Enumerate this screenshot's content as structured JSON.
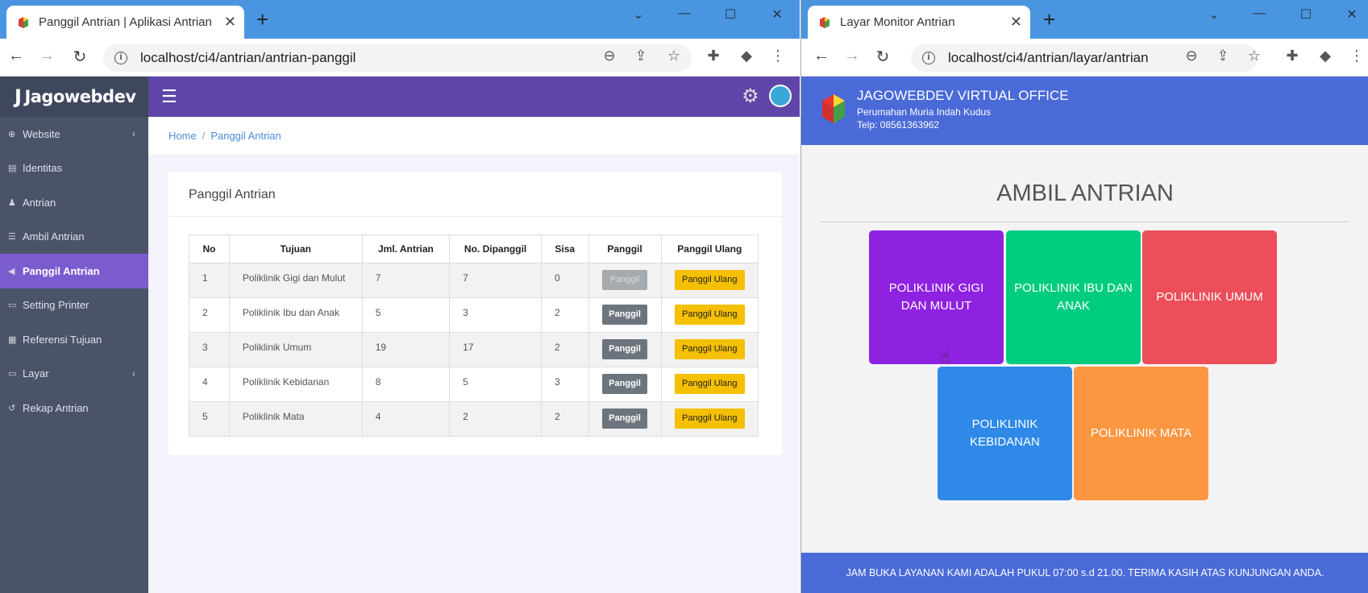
{
  "left_window": {
    "tab_title": "Panggil Antrian | Aplikasi Antrian",
    "url": "localhost/ci4/antrian/antrian-panggil",
    "brand": "Jagowebdev",
    "sidebar": [
      {
        "label": "Website",
        "icon": "globe-icon",
        "has_children": true
      },
      {
        "label": "Identitas",
        "icon": "clipboard-icon",
        "has_children": false
      },
      {
        "label": "Antrian",
        "icon": "users-icon",
        "has_children": false
      },
      {
        "label": "Ambil Antrian",
        "icon": "list-icon",
        "has_children": false
      },
      {
        "label": "Panggil Antrian",
        "icon": "speaker-icon",
        "has_children": false,
        "active": true
      },
      {
        "label": "Setting Printer",
        "icon": "printer-icon",
        "has_children": false
      },
      {
        "label": "Referensi Tujuan",
        "icon": "building-icon",
        "has_children": false
      },
      {
        "label": "Layar",
        "icon": "monitor-icon",
        "has_children": true
      },
      {
        "label": "Rekap Antrian",
        "icon": "history-icon",
        "has_children": false
      }
    ],
    "breadcrumb": {
      "home": "Home",
      "current": "Panggil Antrian"
    },
    "card_title": "Panggil Antrian",
    "table": {
      "headers": [
        "No",
        "Tujuan",
        "Jml. Antrian",
        "No. Dipanggil",
        "Sisa",
        "Panggil",
        "Panggil Ulang"
      ],
      "rows": [
        {
          "no": "1",
          "tujuan": "Poliklinik Gigi dan Mulut",
          "jml": "7",
          "dipanggil": "7",
          "sisa": "0",
          "disabled": true
        },
        {
          "no": "2",
          "tujuan": "Poliklinik Ibu dan Anak",
          "jml": "5",
          "dipanggil": "3",
          "sisa": "2",
          "disabled": false
        },
        {
          "no": "3",
          "tujuan": "Poliklinik Umum",
          "jml": "19",
          "dipanggil": "17",
          "sisa": "2",
          "disabled": false
        },
        {
          "no": "4",
          "tujuan": "Poliklinik Kebidanan",
          "jml": "8",
          "dipanggil": "5",
          "sisa": "3",
          "disabled": false
        },
        {
          "no": "5",
          "tujuan": "Poliklinik Mata",
          "jml": "4",
          "dipanggil": "2",
          "sisa": "2",
          "disabled": false
        }
      ],
      "panggil_label": "Panggil",
      "panggil_ulang_label": "Panggil Ulang"
    }
  },
  "right_window": {
    "tab_title": "Layar Monitor Antrian",
    "url": "localhost/ci4/antrian/layar/antrian",
    "header": {
      "title": "JAGOWEBDEV VIRTUAL OFFICE",
      "address": "Perumahan Muria Indah Kudus",
      "phone": "Telp: 08561363962"
    },
    "heading": "AMBIL ANTRIAN",
    "poliklinik": [
      {
        "label": "POLIKLINIK GIGI DAN MULUT",
        "color": "#8f21e0"
      },
      {
        "label": "POLIKLINIK IBU DAN ANAK",
        "color": "#00cc7f"
      },
      {
        "label": "POLIKLINIK UMUM",
        "color": "#ec4e5a"
      },
      {
        "label": "POLIKLINIK KEBIDANAN",
        "color": "#2f89e8"
      },
      {
        "label": "POLIKLINIK MATA",
        "color": "#fd9641"
      }
    ],
    "footer": "JAM BUKA LAYANAN KAMI ADALAH PUKUL 07:00 s.d 21.00. TERIMA KASIH ATAS KUNJUNGAN ANDA."
  },
  "colors": {
    "tabbar": "#4a95df",
    "sidebar": "#4b5369",
    "topbar": "#5e45a7",
    "active_menu": "#7b5ccf",
    "monitor_header": "#4a6ad8"
  }
}
